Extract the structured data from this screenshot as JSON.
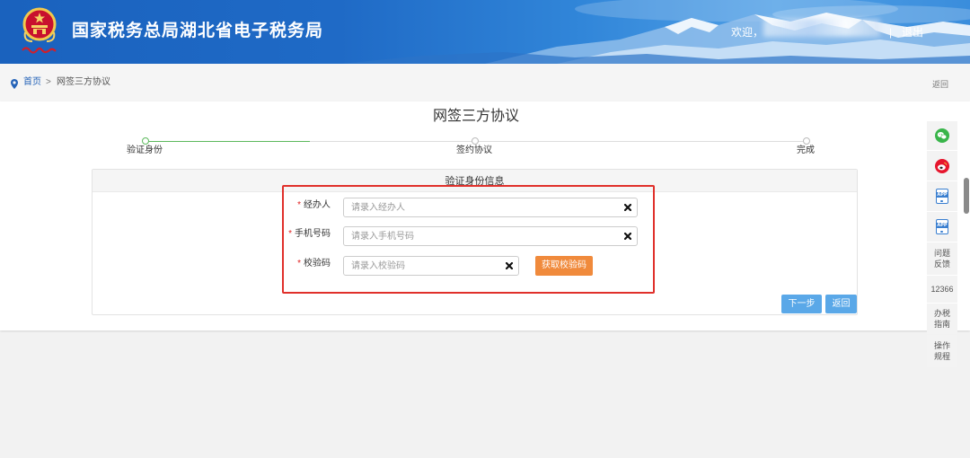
{
  "colors": {
    "header_blue": "#1f6ac6",
    "link_blue": "#2563b8",
    "primary_button": "#5aa8e8",
    "orange_button": "#f08a3c",
    "progress_green": "#5cb85c",
    "required_red": "#e02020",
    "highlight_red": "#e0302b",
    "wechat_green": "#39b54a",
    "weibo_red": "#e6162d"
  },
  "header": {
    "logo_icon": "tax-emblem-icon",
    "title": "国家税务总局湖北省电子税务局",
    "welcome": "欢迎，",
    "separator": "|",
    "logout": "退出"
  },
  "breadcrumb": {
    "location_icon": "map-pin-icon",
    "home": "首页",
    "separator": ">",
    "current": "网签三方协议",
    "back": "返回"
  },
  "page": {
    "title": "网签三方协议",
    "steps": [
      {
        "label": "验证身份",
        "active": true
      },
      {
        "label": "签约协议",
        "active": false
      },
      {
        "label": "完成",
        "active": false
      }
    ],
    "progress": 0.25
  },
  "form": {
    "section_title": "验证身份信息",
    "required_mark": "*",
    "fields": [
      {
        "label": "经办人",
        "placeholder": "请录入经办人",
        "value": ""
      },
      {
        "label": "手机号码",
        "placeholder": "请录入手机号码",
        "value": ""
      },
      {
        "label": "校验码",
        "placeholder": "请录入校验码",
        "value": ""
      }
    ],
    "clear_icon": "close-icon",
    "get_code_button": "获取校验码",
    "next_button": "下一步",
    "back_button": "返回"
  },
  "sidebar": {
    "items": [
      {
        "icon": "wechat-icon"
      },
      {
        "icon": "weibo-icon"
      },
      {
        "icon": "app-icon",
        "icon_text": "APP"
      },
      {
        "icon": "app-icon",
        "icon_text": "APP"
      },
      {
        "label": "问题反馈"
      },
      {
        "label": "12366"
      },
      {
        "label": "办税指南"
      },
      {
        "label": "操作规程"
      }
    ]
  }
}
